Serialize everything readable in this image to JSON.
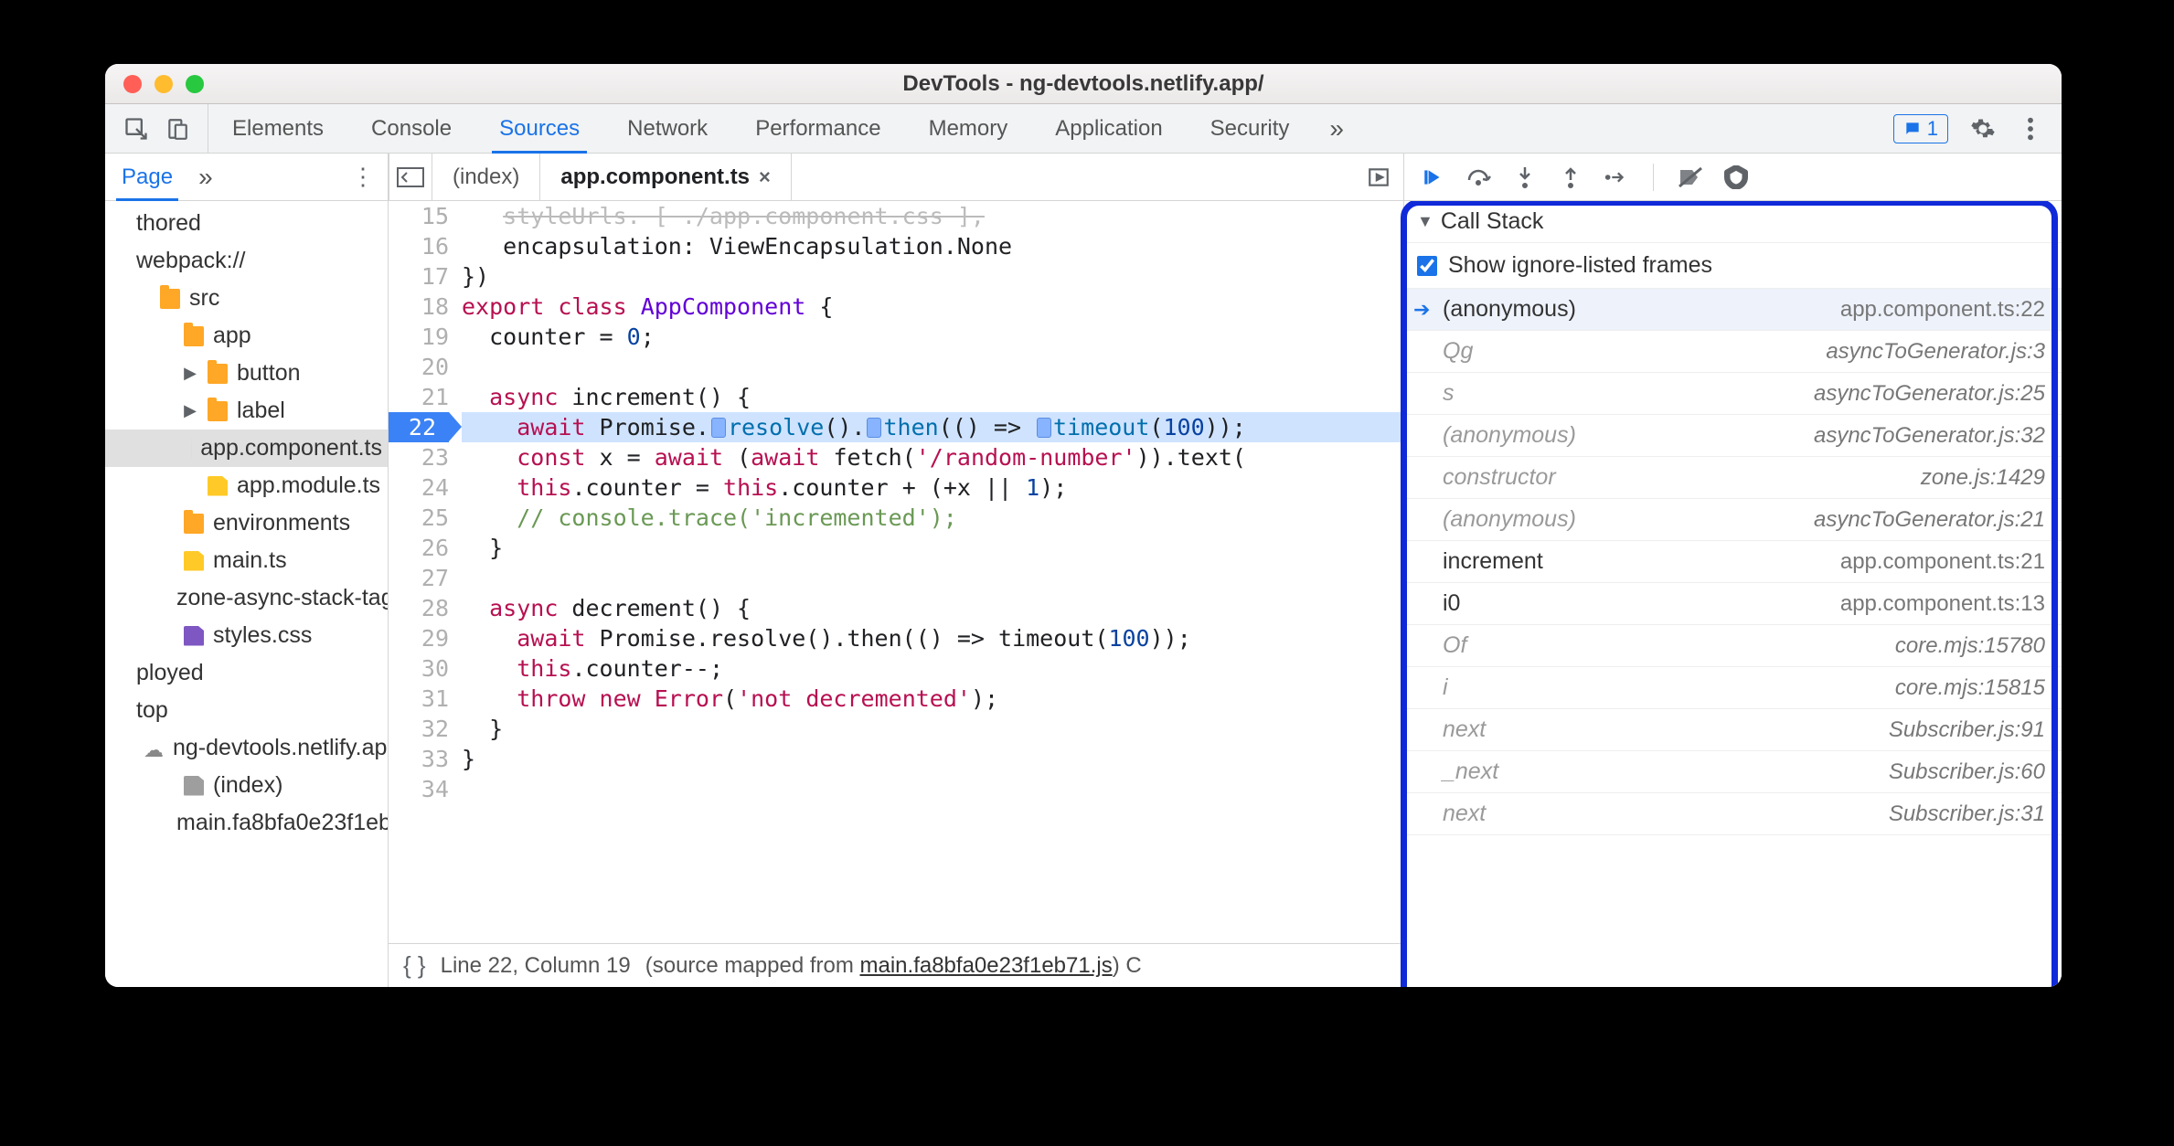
{
  "window": {
    "title": "DevTools - ng-devtools.netlify.app/"
  },
  "mainTabs": [
    "Elements",
    "Console",
    "Sources",
    "Network",
    "Performance",
    "Memory",
    "Application",
    "Security"
  ],
  "mainTabActive": "Sources",
  "overflowGlyph": "»",
  "issueCount": "1",
  "subLeft": {
    "pageLabel": "Page",
    "chev": "»"
  },
  "openFiles": [
    {
      "name": "(index)",
      "active": false,
      "closable": false
    },
    {
      "name": "app.component.ts",
      "active": true,
      "closable": true
    }
  ],
  "tree": [
    {
      "pad": 0,
      "icon": "",
      "label": "thored"
    },
    {
      "pad": 0,
      "icon": "",
      "label": "webpack://"
    },
    {
      "pad": 1,
      "icon": "folder",
      "label": "src"
    },
    {
      "pad": 2,
      "icon": "folder",
      "label": "app"
    },
    {
      "pad": 3,
      "icon": "folder",
      "label": "button",
      "caret": "▶"
    },
    {
      "pad": 3,
      "icon": "folder",
      "label": "label",
      "caret": "▶"
    },
    {
      "pad": 3,
      "icon": "file-yellow",
      "label": "app.component.ts",
      "selected": true
    },
    {
      "pad": 3,
      "icon": "file-yellow",
      "label": "app.module.ts"
    },
    {
      "pad": 2,
      "icon": "folder",
      "label": "environments"
    },
    {
      "pad": 2,
      "icon": "file-yellow",
      "label": "main.ts"
    },
    {
      "pad": 2,
      "icon": "file-yellow",
      "label": "zone-async-stack-tag"
    },
    {
      "pad": 2,
      "icon": "file-purple",
      "label": "styles.css"
    },
    {
      "pad": 0,
      "icon": "",
      "label": "ployed"
    },
    {
      "pad": 0,
      "icon": "",
      "label": "top"
    },
    {
      "pad": 1,
      "icon": "cloud",
      "label": "ng-devtools.netlify.app"
    },
    {
      "pad": 2,
      "icon": "file-grey",
      "label": "(index)"
    },
    {
      "pad": 2,
      "icon": "file-yellow",
      "label": "main.fa8bfa0e23f1eb"
    }
  ],
  "gutterStart": 15,
  "codeLines": [
    {
      "raw": "    styleUrls: [ /app.component.css ],",
      "cut": true,
      "type": "plain"
    },
    {
      "raw": "encap"
    },
    {
      "raw": "close"
    },
    {
      "raw": "export"
    },
    {
      "raw": "counter"
    },
    {
      "raw": "blank"
    },
    {
      "raw": "asyncinc"
    },
    {
      "raw": "await",
      "bp": true
    },
    {
      "raw": "constx"
    },
    {
      "raw": "thiscounter"
    },
    {
      "raw": "comment"
    },
    {
      "raw": "closebrace"
    },
    {
      "raw": "blank"
    },
    {
      "raw": "asyncdec"
    },
    {
      "raw": "awaitdec"
    },
    {
      "raw": "thisdec"
    },
    {
      "raw": "throw"
    },
    {
      "raw": "closebrace"
    },
    {
      "raw": "closebrace2"
    },
    {
      "raw": "blank"
    }
  ],
  "code": {
    "l15": "   styleUrls: [ ./app.component.css ],",
    "l16a": "   encapsulation: ViewEncapsulation.None",
    "l17": "})",
    "l18_export": "export",
    "l18_class": "class",
    "l18_name": "AppComponent",
    "l18_brace": " {",
    "l19": "  counter = ",
    "l19_num": "0",
    "l19_semi": ";",
    "l21_async": "async",
    "l21_rest": " increment() {",
    "l22_await": "await",
    "l22_promise": " Promise.",
    "l22_resolve": "resolve",
    "l22_mid": "().",
    "l22_then": "then",
    "l22_arrow": "(() => ",
    "l22_timeout": "timeout",
    "l22_args": "(",
    "l22_num": "100",
    "l22_end": "));",
    "l23_const": "const",
    "l23_rest": " x = ",
    "l23_await": "await",
    "l23_mid": " (",
    "l23_await2": "await",
    "l23_fetch": " fetch(",
    "l23_str": "'/random-number'",
    "l23_end": ")).text(",
    "l24_this": "this",
    "l24_mid": ".counter = ",
    "l24_this2": "this",
    "l24_rest": ".counter + (+x || ",
    "l24_num": "1",
    "l24_end": ");",
    "l25": "    // console.trace('incremented');",
    "l26": "  }",
    "l28_async": "async",
    "l28_rest": " decrement() {",
    "l29_await": "await",
    "l29_rest": " Promise.resolve().then(() => timeout(",
    "l29_num": "100",
    "l29_end": "));",
    "l30_this": "this",
    "l30_rest": ".counter--;",
    "l31_throw": "throw",
    "l31_new": " new",
    "l31_err": " Error",
    "l31_open": "(",
    "l31_str": "'not decremented'",
    "l31_end": ");",
    "l32": "  }",
    "l33": "}"
  },
  "status": {
    "lineCol": "Line 22, Column 19",
    "mapPrefix": " (source mapped from ",
    "mapLink": "main.fa8bfa0e23f1eb71.js",
    "mapSuffix": ")  C"
  },
  "callStack": {
    "title": "Call Stack",
    "showIgnored": "Show ignore-listed frames",
    "frames": [
      {
        "name": "(anonymous)",
        "loc": "app.component.ts:22",
        "current": true,
        "ignored": false
      },
      {
        "name": "Qg",
        "loc": "asyncToGenerator.js:3",
        "ignored": true
      },
      {
        "name": "s",
        "loc": "asyncToGenerator.js:25",
        "ignored": true
      },
      {
        "name": "(anonymous)",
        "loc": "asyncToGenerator.js:32",
        "ignored": true
      },
      {
        "name": "constructor",
        "loc": "zone.js:1429",
        "ignored": true
      },
      {
        "name": "(anonymous)",
        "loc": "asyncToGenerator.js:21",
        "ignored": true
      },
      {
        "name": "increment",
        "loc": "app.component.ts:21",
        "ignored": false
      },
      {
        "name": "i0",
        "loc": "app.component.ts:13",
        "ignored": false
      },
      {
        "name": "Of",
        "loc": "core.mjs:15780",
        "ignored": true
      },
      {
        "name": "i",
        "loc": "core.mjs:15815",
        "ignored": true
      },
      {
        "name": "next",
        "loc": "Subscriber.js:91",
        "ignored": true
      },
      {
        "name": "_next",
        "loc": "Subscriber.js:60",
        "ignored": true
      },
      {
        "name": "next",
        "loc": "Subscriber.js:31",
        "ignored": true
      }
    ]
  }
}
